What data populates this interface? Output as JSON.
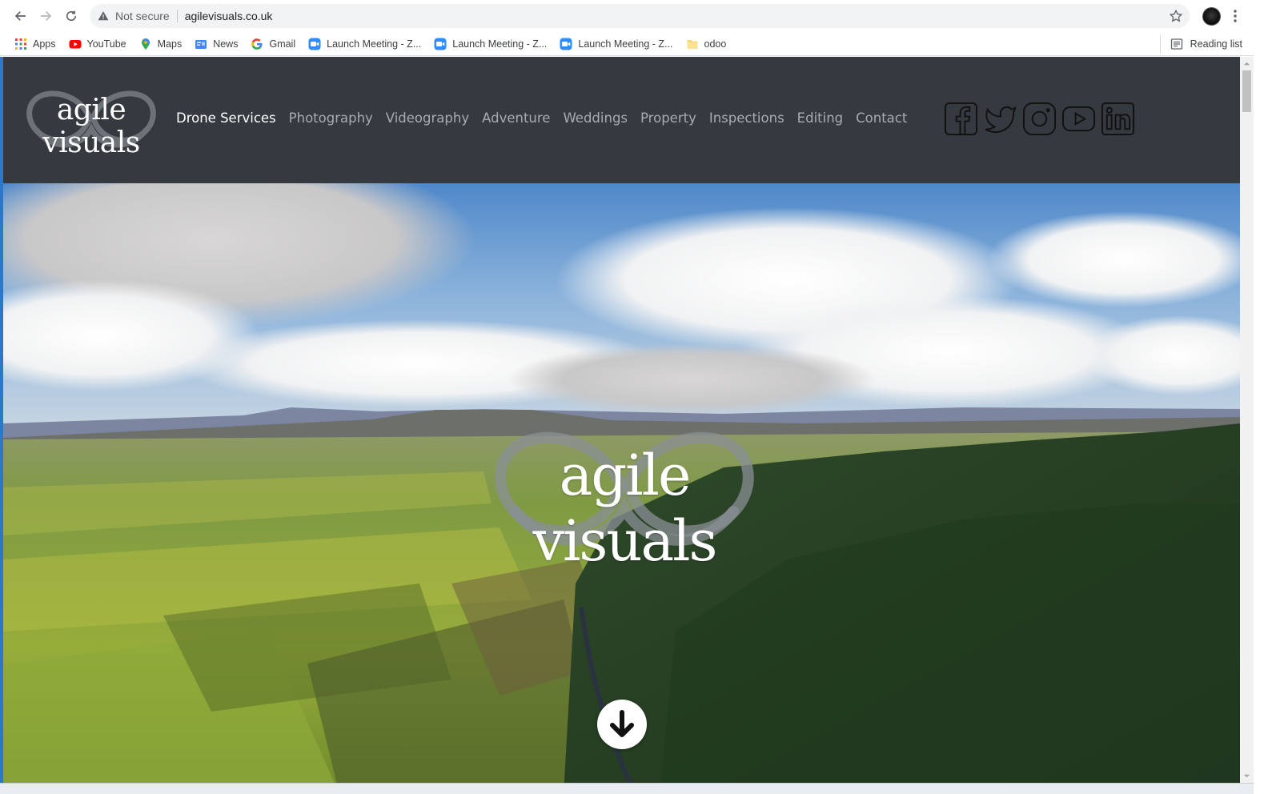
{
  "browser": {
    "security_label": "Not secure",
    "url": "agilevisuals.co.uk",
    "bookmarks": [
      {
        "label": "Apps",
        "icon": "apps-grid-icon"
      },
      {
        "label": "YouTube",
        "icon": "youtube-icon"
      },
      {
        "label": "Maps",
        "icon": "maps-pin-icon"
      },
      {
        "label": "News",
        "icon": "news-icon"
      },
      {
        "label": "Gmail",
        "icon": "google-g-icon"
      },
      {
        "label": "Launch Meeting - Z...",
        "icon": "zoom-icon"
      },
      {
        "label": "Launch Meeting - Z...",
        "icon": "zoom-icon"
      },
      {
        "label": "Launch Meeting - Z...",
        "icon": "zoom-icon"
      },
      {
        "label": "odoo",
        "icon": "folder-icon"
      }
    ],
    "reading_list": "Reading list"
  },
  "site": {
    "logo_text": "agile visuals",
    "nav": [
      {
        "label": "Drone Services",
        "active": true
      },
      {
        "label": "Photography",
        "active": false
      },
      {
        "label": "Videography",
        "active": false
      },
      {
        "label": "Adventure",
        "active": false
      },
      {
        "label": "Weddings",
        "active": false
      },
      {
        "label": "Property",
        "active": false
      },
      {
        "label": "Inspections",
        "active": false
      },
      {
        "label": "Editing",
        "active": false
      },
      {
        "label": "Contact",
        "active": false
      }
    ],
    "social": [
      "facebook-icon",
      "twitter-icon",
      "instagram-icon",
      "youtube-icon",
      "linkedin-icon"
    ],
    "hero_text": "agile visuals",
    "colors": {
      "header_bg": "#343a40",
      "nav_active": "#ffffff",
      "nav_inactive": "#a9acaf"
    }
  }
}
